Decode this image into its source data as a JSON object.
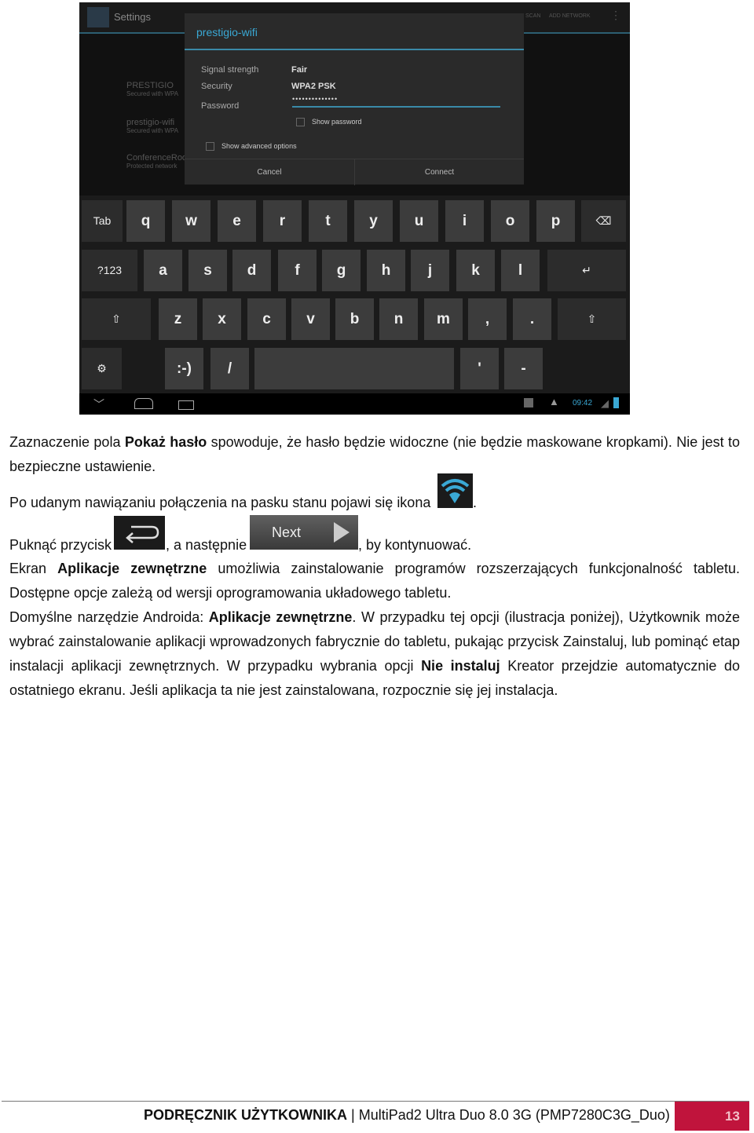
{
  "screenshot": {
    "app_title": "Settings",
    "top_actions": [
      "SCAN",
      "ADD NETWORK"
    ],
    "background_list": [
      {
        "name": "PRESTIGIO",
        "sub": "Secured with WPA"
      },
      {
        "name": "prestigio-wifi",
        "sub": "Secured with WPA"
      },
      {
        "name": "ConferenceRoo",
        "sub": "Protected network"
      }
    ],
    "dialog": {
      "title": "prestigio-wifi",
      "signal_label": "Signal strength",
      "signal_value": "Fair",
      "security_label": "Security",
      "security_value": "WPA2 PSK",
      "password_label": "Password",
      "password_value": "••••••••••••••",
      "show_password": "Show password",
      "show_advanced": "Show advanced options",
      "cancel": "Cancel",
      "connect": "Connect"
    },
    "keyboard": {
      "row1": [
        "Tab",
        "q",
        "w",
        "e",
        "r",
        "t",
        "y",
        "u",
        "i",
        "o",
        "p",
        "⌫"
      ],
      "row2": [
        "?123",
        "a",
        "s",
        "d",
        "f",
        "g",
        "h",
        "j",
        "k",
        "l",
        "↵"
      ],
      "row3": [
        "⇧",
        "z",
        "x",
        "c",
        "v",
        "b",
        "n",
        "m",
        ",",
        ".",
        "⇧"
      ],
      "row4": [
        "⚙",
        ":-)",
        "/",
        "",
        "'",
        "-"
      ]
    },
    "status": {
      "time": "09:42"
    }
  },
  "text": {
    "p1a": "Zaznaczenie pola ",
    "p1b": "Pokaż hasło",
    "p1c": " spowoduje, że hasło będzie widoczne (nie będzie maskowane kropkami). Nie jest to bezpieczne ustawienie.",
    "p2": "Po udanym nawiązaniu połączenia na pasku stanu pojawi się ikona",
    "p2end": ".",
    "p3a": "Puknąć przycisk",
    "p3b": ", a następnie",
    "p3c": ", by kontynuować.",
    "next_button": "Next",
    "p4a": "Ekran ",
    "p4b": "Aplikacje zewnętrzne",
    "p4c": " umożliwia zainstalowanie programów rozszerzających funkcjonalność tabletu. Dostępne opcje zależą od wersji oprogramowania układowego tabletu.",
    "p5a": "Domyślne narzędzie Androida: ",
    "p5b": "Aplikacje zewnętrzne",
    "p5c": ". W przypadku tej opcji (ilustracja poniżej), Użytkownik może wybrać zainstalowanie aplikacji wprowadzonych fabrycznie do tabletu, pukając przycisk Zainstaluj, lub pominąć etap instalacji aplikacji zewnętrznych. W przypadku wybrania opcji ",
    "p5d": "Nie instaluj",
    "p5e": " Kreator przejdzie automatycznie do ostatniego ekranu. Jeśli aplikacja ta nie jest zainstalowana, rozpocznie się jej instalacja."
  },
  "footer": {
    "manual": "PODRĘCZNIK UŻYTKOWNIKA",
    "sep": "|",
    "model": "MultiPad2 Ultra Duo 8.0 3G  (PMP7280C3G_Duo)",
    "page": "13",
    "accent": "#c0143c"
  }
}
